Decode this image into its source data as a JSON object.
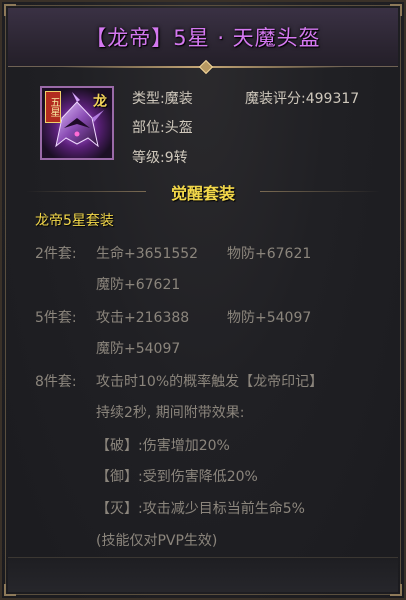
{
  "title": "【龙帝】5星 · 天魔头盔",
  "item": {
    "icon": "demon-helmet-icon",
    "star_badge": "五星",
    "dragon_mark": "龙",
    "type_label": "类型:",
    "type_value": "魔装",
    "score_label": "魔装评分:",
    "score_value": "499317",
    "slot_label": "部位:",
    "slot_value": "头盔",
    "level_label": "等级:",
    "level_value": "9转"
  },
  "awaken": {
    "section_title": "觉醒套装",
    "set_name": "龙帝5星套装",
    "two_piece": {
      "label": "2件套:",
      "stat1": "生命+3651552",
      "stat2": "物防+67621",
      "stat3": "魔防+67621"
    },
    "five_piece": {
      "label": "5件套:",
      "stat1": "攻击+216388",
      "stat2": "物防+54097",
      "stat3": "魔防+54097"
    },
    "eight_piece": {
      "label": "8件套:",
      "line1": "攻击时10%的概率触发【龙帝印记】",
      "line2": "持续2秒, 期间附带效果:",
      "line3": "【破】:伤害增加20%",
      "line4": "【御】:受到伤害降低20%",
      "line5": "【灭】:攻击减少目标当前生命5%",
      "line6": "(技能仅对PVP生效)"
    }
  },
  "colors": {
    "title": "#d478f0",
    "gold": "#f3d84a",
    "muted": "#8b857c",
    "info": "#cfc8bc"
  }
}
